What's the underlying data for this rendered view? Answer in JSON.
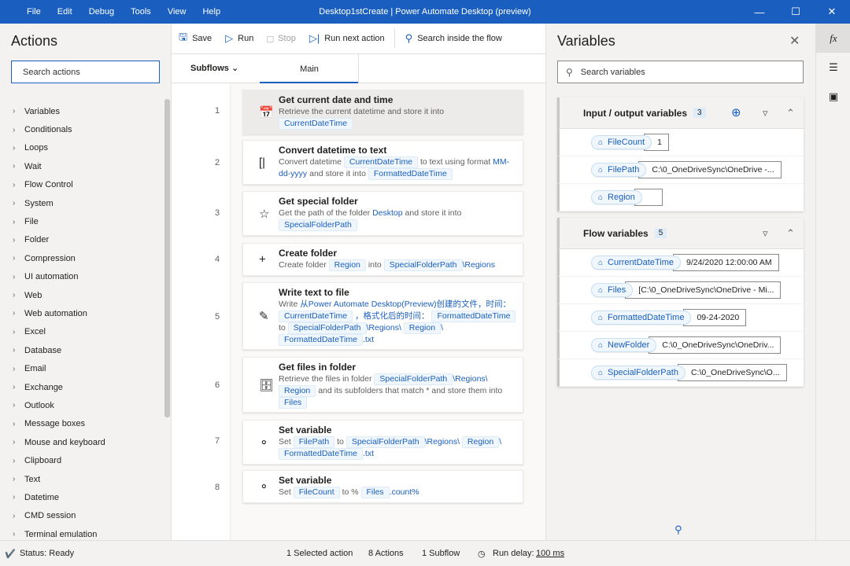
{
  "window": {
    "menu": [
      "File",
      "Edit",
      "Debug",
      "Tools",
      "View",
      "Help"
    ],
    "title": "Desktop1stCreate | Power Automate Desktop (preview)",
    "controls": [
      "minimize-icon",
      "maximize-icon",
      "close-icon"
    ]
  },
  "actions_panel": {
    "title": "Actions",
    "search_placeholder": "Search actions",
    "categories": [
      "Variables",
      "Conditionals",
      "Loops",
      "Wait",
      "Flow Control",
      "System",
      "File",
      "Folder",
      "Compression",
      "UI automation",
      "Web",
      "Web automation",
      "Excel",
      "Database",
      "Email",
      "Exchange",
      "Outlook",
      "Message boxes",
      "Mouse and keyboard",
      "Clipboard",
      "Text",
      "Datetime",
      "CMD session",
      "Terminal emulation"
    ]
  },
  "toolbar": {
    "save": "Save",
    "run": "Run",
    "stop": "Stop",
    "run_next": "Run next action",
    "search_flow": "Search inside the flow"
  },
  "tabs": {
    "subflows": "Subflows",
    "main": "Main"
  },
  "steps": [
    {
      "num": "1",
      "title": "Get current date and time",
      "icon": "calendar-icon"
    },
    {
      "num": "2",
      "title": "Convert datetime to text",
      "icon": "convert-icon"
    },
    {
      "num": "3",
      "title": "Get special folder",
      "icon": "star-icon"
    },
    {
      "num": "4",
      "title": "Create folder",
      "icon": "plus-icon"
    },
    {
      "num": "5",
      "title": "Write text to file",
      "icon": "pen-icon"
    },
    {
      "num": "6",
      "title": "Get files in folder",
      "icon": "folder-files-icon"
    },
    {
      "num": "7",
      "title": "Set variable",
      "icon": "set-variable-icon"
    },
    {
      "num": "8",
      "title": "Set variable",
      "icon": "set-variable-icon"
    }
  ],
  "step_text": {
    "s1": {
      "a": "Retrieve the current datetime and store it into",
      "v1": "CurrentDateTime"
    },
    "s2": {
      "a": "Convert datetime",
      "v1": "CurrentDateTime",
      "b": "to text using format",
      "fmt": "MM-dd-yyyy",
      "c": "and store it into",
      "v2": "FormattedDateTime"
    },
    "s3": {
      "a": "Get the path of the folder",
      "lnk": "Desktop",
      "b": "and store it into",
      "v1": "SpecialFolderPath"
    },
    "s4": {
      "a": "Create folder",
      "v1": "Region",
      "b": "into",
      "v2": "SpecialFolderPath",
      "c": "\\Regions"
    },
    "s5": {
      "a": "Write",
      "lnk": "从Power Automate Desktop(Preview)创建的文件，时间：",
      "v1": "CurrentDateTime",
      "b": "，格式化后的时间：",
      "v2": "FormattedDateTime",
      "c": "to",
      "v3": "SpecialFolderPath",
      "d": "\\Regions\\",
      "v4": "Region",
      "e": "\\",
      "v5": "FormattedDateTime",
      "f": ".txt"
    },
    "s6": {
      "a": "Retrieve the files in folder",
      "v1": "SpecialFolderPath",
      "b": "\\Regions\\",
      "v2": "Region",
      "c": "and its subfolders that match * and store them into",
      "v3": "Files"
    },
    "s7": {
      "a": "Set",
      "v1": "FilePath",
      "b": "to",
      "v2": "SpecialFolderPath",
      "c": "\\Regions\\",
      "v3": "Region",
      "d": "\\",
      "v4": "FormattedDateTime",
      "e": ".txt"
    },
    "s8": {
      "a": "Set",
      "v1": "FileCount",
      "b": "to %",
      "v2": "Files",
      "c": ".count%"
    }
  },
  "variables_panel": {
    "title": "Variables",
    "search_placeholder": "Search variables",
    "io_section": {
      "title": "Input / output variables",
      "count": "3",
      "items": [
        {
          "name": "FileCount",
          "value": "1"
        },
        {
          "name": "FilePath",
          "value": "C:\\0_OneDriveSync\\OneDrive -..."
        },
        {
          "name": "Region",
          "value": ""
        }
      ]
    },
    "flow_section": {
      "title": "Flow variables",
      "count": "5",
      "items": [
        {
          "name": "CurrentDateTime",
          "value": "9/24/2020 12:00:00 AM"
        },
        {
          "name": "Files",
          "value": "[C:\\0_OneDriveSync\\OneDrive - Mi..."
        },
        {
          "name": "FormattedDateTime",
          "value": "09-24-2020"
        },
        {
          "name": "NewFolder",
          "value": "C:\\0_OneDriveSync\\OneDriv..."
        },
        {
          "name": "SpecialFolderPath",
          "value": "C:\\0_OneDriveSync\\O..."
        }
      ]
    }
  },
  "rail": [
    "fx-icon",
    "layers-icon",
    "image-icon"
  ],
  "rail_label": "fx",
  "statusbar": {
    "status": "Status: Ready",
    "selected": "1 Selected action",
    "actions": "8 Actions",
    "subflows": "1 Subflow",
    "run_delay_label": "Run delay:",
    "run_delay_value": "100 ms"
  }
}
